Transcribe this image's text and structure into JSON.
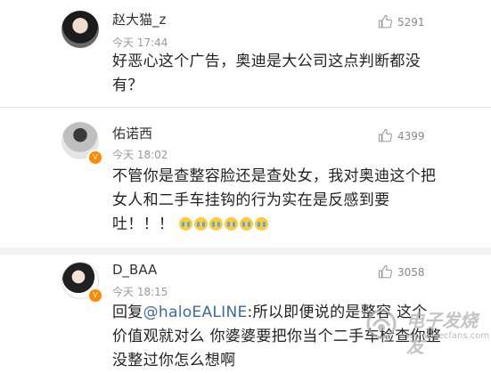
{
  "comments": [
    {
      "username": "赵大猫_z",
      "time": "今天 17:44",
      "likes": "5291",
      "text": "好恶心这个广告，奥迪是大公司这点判断都没有？"
    },
    {
      "username": "佑诺西",
      "time": "今天 18:02",
      "likes": "4399",
      "text": "不管你是查整容脸还是查处女，我对奥迪这个把女人和二手车挂钩的行为实在是反感到要吐！！！"
    },
    {
      "username": "D_BAA",
      "time": "今天 18:15",
      "likes": "3058",
      "text_prefix": "回复",
      "mention": "@haloEALINE",
      "text_suffix": ":所以即便说的是整容 这个价值观就对么 你婆婆要把你当个二手车检查你整没整过你怎么想啊"
    }
  ],
  "watermark": {
    "name": "电子发烧友",
    "url": "www.elecfans.com"
  },
  "icons": {
    "like": "thumbs-up-icon",
    "verified": "verified-badge-icon",
    "emoji": "crying-face-emoji"
  },
  "colors": {
    "mention": "#3c6a9f",
    "verified_badge": "#ff8a00",
    "time": "#999999"
  }
}
